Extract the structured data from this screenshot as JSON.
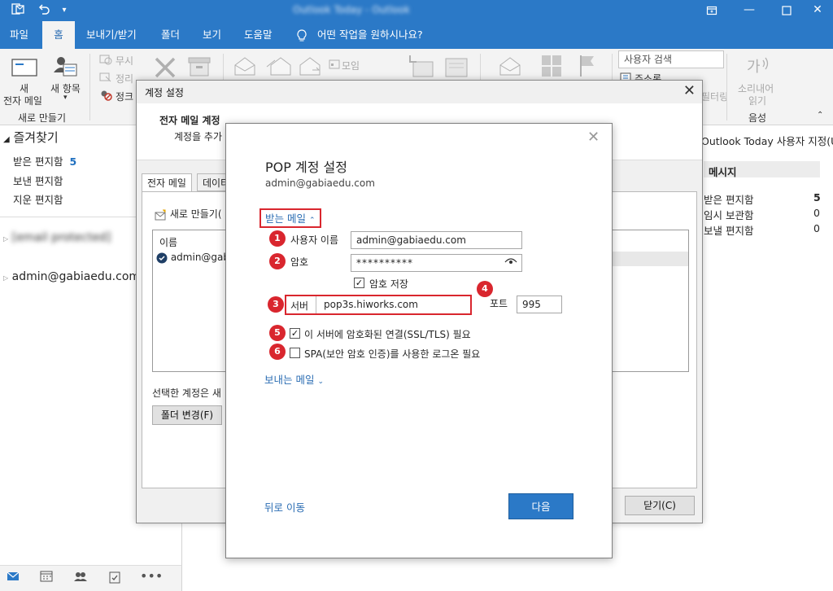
{
  "titlebar": {
    "title_blurred": "Outlook Today - Outlook",
    "icons": [
      "outlook-app-icon",
      "undo-icon",
      "quick-access-dropdown-icon"
    ],
    "controls": [
      "restore-icon",
      "minimize-icon",
      "maximize-icon",
      "close-icon"
    ]
  },
  "menu": {
    "items": [
      "파일",
      "홈",
      "보내기/받기",
      "폴더",
      "보기",
      "도움말"
    ],
    "active": "홈",
    "tell_me": "어떤 작업을 원하시나요?"
  },
  "ribbon": {
    "new_email_line1": "새",
    "new_email_line2": "전자 메일",
    "new_items": "새 항목",
    "group_new": "새로 만들기",
    "ignore": "무시",
    "cleanup": "정리",
    "junk": "정크",
    "meeting": "모임",
    "search_people_placeholder": "사용자 검색",
    "address_book": "주소록",
    "filter": "필터링",
    "speech_line1": "소리내어",
    "speech_line2": "읽기",
    "group_speech": "음성"
  },
  "leftpane": {
    "favorites": "즐겨찾기",
    "inbox": "받은 편지함",
    "inbox_count": "5",
    "sent": "보낸 편지함",
    "deleted": "지운 편지함",
    "account_blurred": "[email protected]",
    "account2": "admin@gabiaedu.com"
  },
  "rightarea": {
    "customize": "Outlook Today 사용자 지정(U) ...",
    "messages_header": "메시지",
    "rows": [
      {
        "name": "받은 편지함",
        "count": "5"
      },
      {
        "name": "임시 보관함",
        "count": "0"
      },
      {
        "name": "보낼 편지함",
        "count": "0"
      }
    ]
  },
  "account_dialog": {
    "title": "계정 설정",
    "header_title": "전자 메일 계정",
    "header_sub": "계정을 추가",
    "tab_email": "전자 메일",
    "tab_data": "데이터",
    "new_button": "새로 만들기(",
    "col_name": "이름",
    "row_account": "admin@gab",
    "selected_note": "선택한 계정은 새",
    "change_folder": "폴더 변경(F)",
    "close_button": "닫기(C)"
  },
  "pop_dialog": {
    "title": "POP 계정 설정",
    "email": "admin@gabiaedu.com",
    "incoming_section": "받는 메일",
    "username_label": "사용자 이름",
    "username_value": "admin@gabiaedu.com",
    "password_label": "암호",
    "password_value": "**********",
    "save_password": "암호 저장",
    "server_label": "서버",
    "server_value": "pop3s.hiworks.com",
    "port_label": "포트",
    "port_value": "995",
    "ssl_label": "이 서버에 암호화된 연결(SSL/TLS) 필요",
    "spa_label": "SPA(보안 암호 인증)를 사용한 로그온 필요",
    "outgoing_section": "보내는 메일",
    "back_link": "뒤로 이동",
    "next_button": "다음",
    "badges": [
      "1",
      "2",
      "3",
      "4",
      "5",
      "6"
    ]
  },
  "colors": {
    "accent": "#2b79c7",
    "highlight_red": "#d9262e",
    "link_blue": "#2b6db3"
  }
}
